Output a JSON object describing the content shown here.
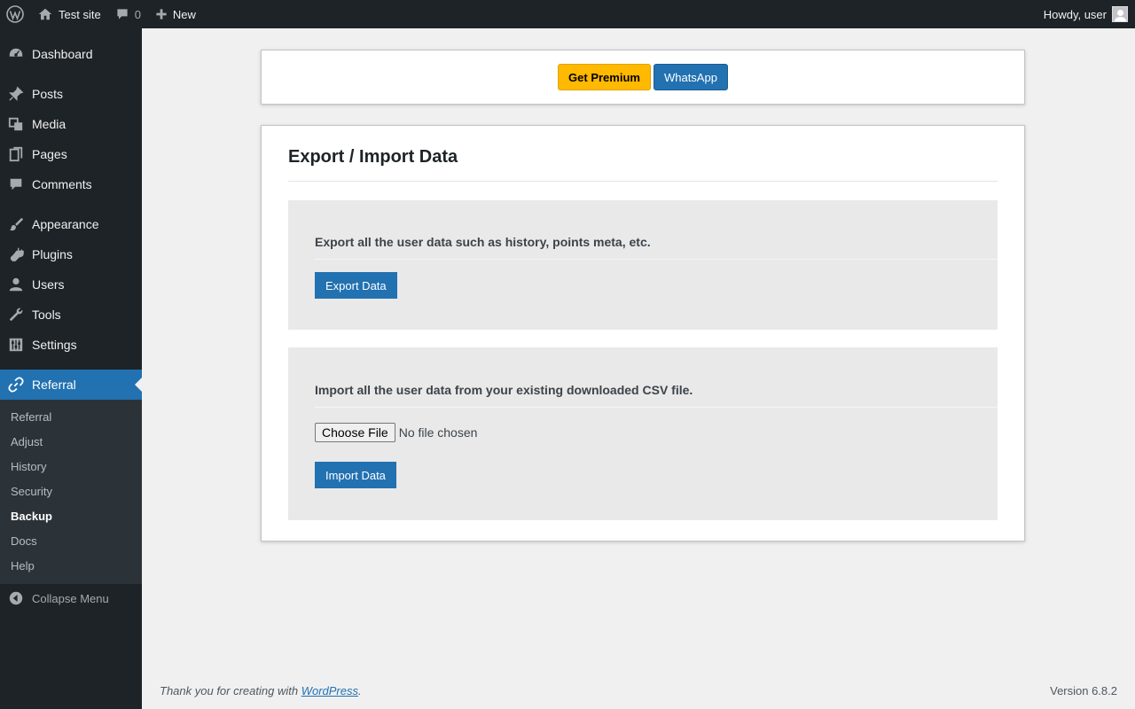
{
  "adminbar": {
    "site_name": "Test site",
    "comments_count": "0",
    "new_label": "New",
    "greeting": "Howdy, user"
  },
  "sidebar": {
    "items": [
      {
        "label": "Dashboard",
        "icon": "dashboard-icon"
      },
      {
        "label": "Posts",
        "icon": "pin-icon"
      },
      {
        "label": "Media",
        "icon": "media-icon"
      },
      {
        "label": "Pages",
        "icon": "pages-icon"
      },
      {
        "label": "Comments",
        "icon": "comment-icon"
      },
      {
        "label": "Appearance",
        "icon": "brush-icon"
      },
      {
        "label": "Plugins",
        "icon": "plug-icon"
      },
      {
        "label": "Users",
        "icon": "user-icon"
      },
      {
        "label": "Tools",
        "icon": "wrench-icon"
      },
      {
        "label": "Settings",
        "icon": "sliders-icon"
      },
      {
        "label": "Referral",
        "icon": "link-icon"
      }
    ],
    "submenu": [
      "Referral",
      "Adjust",
      "History",
      "Security",
      "Backup",
      "Docs",
      "Help"
    ],
    "collapse_label": "Collapse Menu"
  },
  "top_panel": {
    "premium_label": "Get Premium",
    "whatsapp_label": "WhatsApp"
  },
  "main": {
    "title": "Export / Import Data",
    "export": {
      "heading": "Export all the user data such as history, points meta, etc.",
      "button": "Export Data"
    },
    "import": {
      "heading": "Import all the user data from your existing downloaded CSV file.",
      "choose_label": "Choose File",
      "file_status": "No file chosen",
      "button": "Import Data"
    }
  },
  "footer": {
    "thanks_prefix": "Thank you for creating with ",
    "link_text": "WordPress",
    "suffix": ".",
    "version": "Version 6.8.2"
  }
}
